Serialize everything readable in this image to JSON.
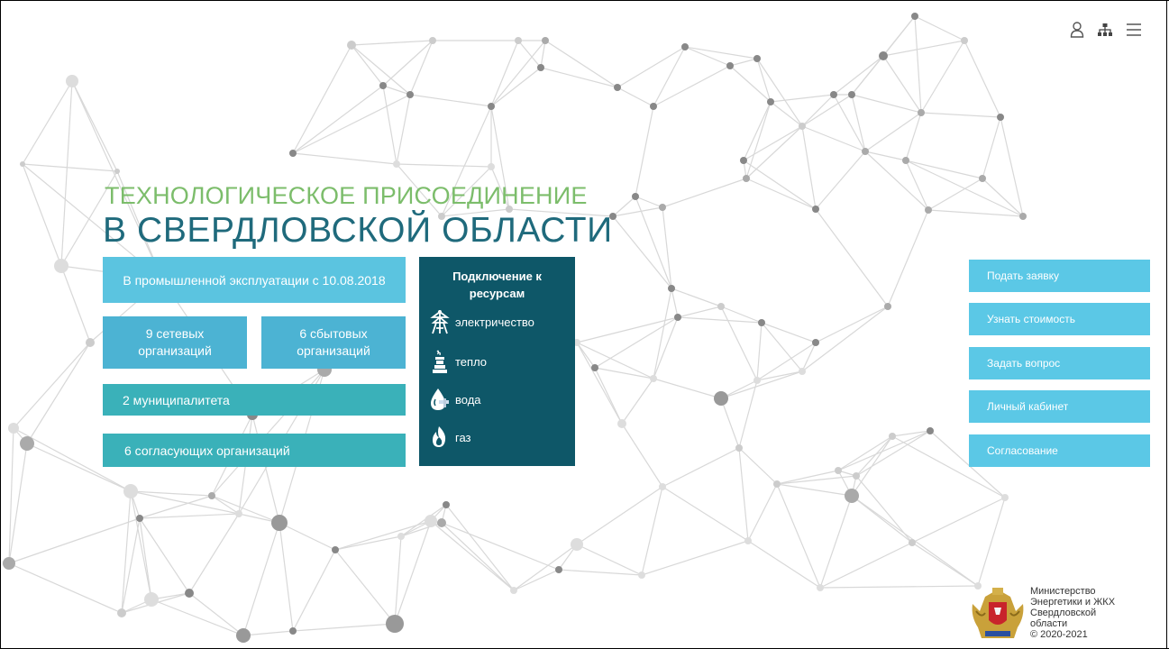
{
  "header": {
    "icons": [
      "user-icon",
      "sitemap-icon",
      "menu-icon"
    ]
  },
  "hero": {
    "title_line1": "ТЕХНОЛОГИЧЕСКОЕ ПРИСОЕДИНЕНИЕ",
    "title_line2": "В СВЕРДЛОВСКОЙ ОБЛАСТИ"
  },
  "stats": {
    "production": "В промышленной эксплуатации с 10.08.2018",
    "network_orgs_line1": "9 сетевых",
    "network_orgs_line2": "организаций",
    "sales_orgs_line1": "6 сбытовых",
    "sales_orgs_line2": "организаций",
    "municipalities": "2 муниципалитета",
    "approving_orgs": "6 согласующих организаций"
  },
  "resources": {
    "title_line1": "Подключение к",
    "title_line2": "ресурсам",
    "items": [
      {
        "label": "электричество",
        "icon": "power-tower-icon"
      },
      {
        "label": "тепло",
        "icon": "chimney-icon"
      },
      {
        "label": "вода",
        "icon": "water-drop-icon"
      },
      {
        "label": "газ",
        "icon": "flame-icon"
      }
    ]
  },
  "actions": [
    {
      "label": "Подать заявку"
    },
    {
      "label": "Узнать стоимость"
    },
    {
      "label": "Задать вопрос"
    },
    {
      "label": "Личный кабинет"
    },
    {
      "label": "Согласование"
    }
  ],
  "ministry": {
    "line1": "Министерство",
    "line2": "Энергетики и ЖКХ",
    "line3": "Свердловской",
    "line4": "области",
    "copyright": "© 2020-2021"
  },
  "colors": {
    "title_green": "#7cbd6b",
    "title_blue": "#1f6a7c",
    "panel_dark": "#0e5768",
    "button_light": "#5bc8e6",
    "teal": "#3ab1b9"
  }
}
